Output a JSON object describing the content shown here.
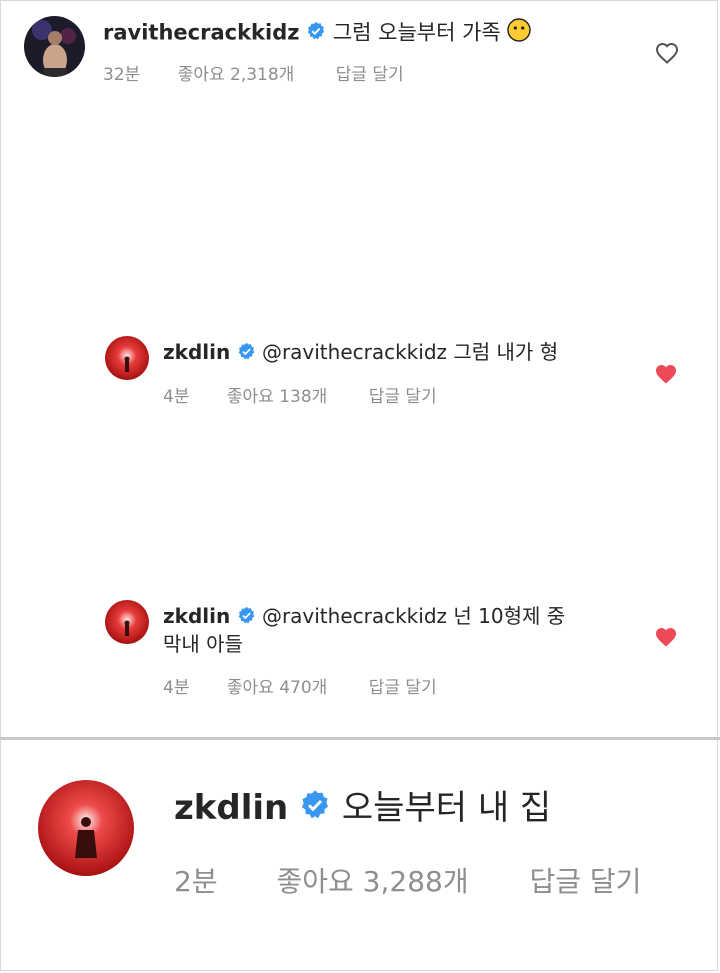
{
  "comments": [
    {
      "username": "ravithecrackkidz",
      "text": "그럼 오늘부터 가족",
      "emoji": "neutral-face-emoji",
      "time": "32분",
      "likes": "좋아요 2,318개",
      "reply": "답글 달기",
      "liked": false,
      "verified": true
    },
    {
      "username": "zkdlin",
      "text": "@ravithecrackkidz 그럼 내가 형",
      "time": "4분",
      "likes": "좋아요 138개",
      "reply": "답글 달기",
      "liked": true,
      "verified": true
    },
    {
      "username": "zkdlin",
      "text_line1": "@ravithecrackkidz 넌 10형제 중",
      "text_line2": "막내 아들",
      "time": "4분",
      "likes": "좋아요 470개",
      "reply": "답글 달기",
      "liked": true,
      "verified": true
    },
    {
      "username": "zkdlin",
      "text": "오늘부터 내 집",
      "time": "2분",
      "likes": "좋아요 3,288개",
      "reply": "답글 달기",
      "verified": true
    }
  ],
  "colors": {
    "verified_blue": "#3897f0",
    "liked_heart": "#ed4956",
    "meta_gray": "#8e8e8e",
    "avatar_red": "#c8102e"
  }
}
